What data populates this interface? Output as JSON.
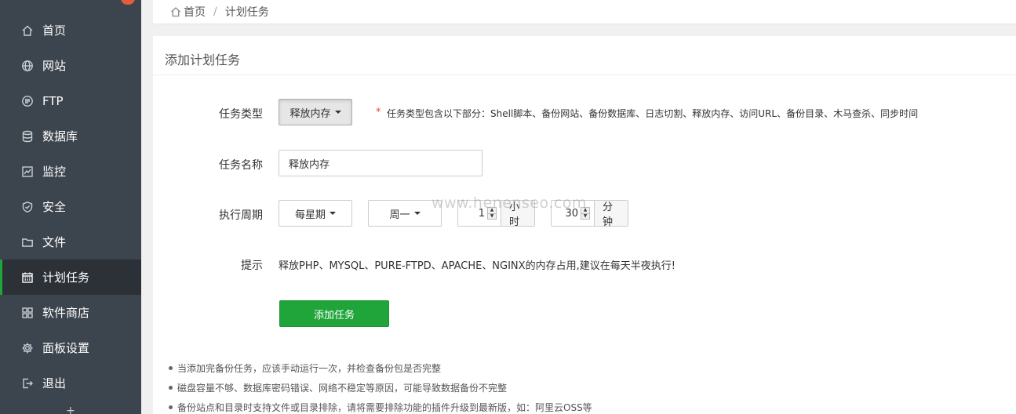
{
  "sidebar": {
    "items": [
      {
        "label": "首页",
        "icon": "home-icon"
      },
      {
        "label": "网站",
        "icon": "globe-icon"
      },
      {
        "label": "FTP",
        "icon": "ftp-icon"
      },
      {
        "label": "数据库",
        "icon": "database-icon"
      },
      {
        "label": "监控",
        "icon": "monitor-chart-icon"
      },
      {
        "label": "安全",
        "icon": "shield-icon"
      },
      {
        "label": "文件",
        "icon": "folder-icon"
      },
      {
        "label": "计划任务",
        "icon": "calendar-icon",
        "active": true
      },
      {
        "label": "软件商店",
        "icon": "grid-apps-icon"
      },
      {
        "label": "面板设置",
        "icon": "gear-icon"
      },
      {
        "label": "退出",
        "icon": "logout-icon"
      }
    ],
    "more_glyph": "+"
  },
  "breadcrumb": {
    "home": "首页",
    "separator": "/",
    "current": "计划任务"
  },
  "panel": {
    "title": "添加计划任务"
  },
  "form": {
    "task_type": {
      "label": "任务类型",
      "value": "释放内存",
      "hint_star": "*",
      "hint": "任务类型包含以下部分：Shell脚本、备份网站、备份数据库、日志切割、释放内存、访问URL、备份目录、木马查杀、同步时间"
    },
    "task_name": {
      "label": "任务名称",
      "value": "释放内存"
    },
    "cycle": {
      "label": "执行周期",
      "period": "每星期",
      "weekday": "周一",
      "hour": "1",
      "hour_unit": "小时",
      "minute": "30",
      "minute_unit": "分钟"
    },
    "tip": {
      "label": "提示",
      "text": "释放PHP、MYSQL、PURE-FTPD、APACHE、NGINX的内存占用,建议在每天半夜执行!"
    },
    "submit_label": "添加任务"
  },
  "notes": [
    "当添加完备份任务，应该手动运行一次，并检查备份包是否完整",
    "磁盘容量不够、数据库密码错误、网络不稳定等原因，可能导致数据备份不完整",
    "备份站点和目录时支持文件或目录排除，请将需要排除功能的插件升级到最新版，如：阿里云OSS等"
  ],
  "watermark": "www.henenseo.com",
  "colors": {
    "sidebar_bg": "#3c444d",
    "active_bg": "#2c3138",
    "accent_green": "#20a53a",
    "badge_red": "#e25c3e"
  }
}
